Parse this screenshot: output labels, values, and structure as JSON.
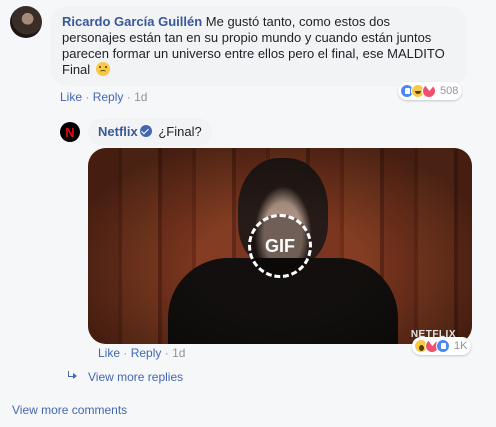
{
  "comment": {
    "author": "Ricardo García Guillén",
    "text": "Me gustó tanto, como estos dos personajes están tan en su propio mundo y cuando están juntos parecen formar un universo entre ellos pero el final, ese MALDITO Final",
    "emoji": "sad-face-emoji",
    "like_label": "Like",
    "reply_label": "Reply",
    "time": "1d",
    "reactions": [
      "like",
      "haha",
      "love"
    ],
    "reaction_count": "508"
  },
  "reply": {
    "author": "Netflix",
    "avatar_letter": "N",
    "verified": true,
    "text": "¿Final?",
    "gif_label": "GIF",
    "gif_watermark": "NETFLIX",
    "like_label": "Like",
    "reply_label": "Reply",
    "time": "1d",
    "reactions": [
      "wow",
      "love",
      "like"
    ],
    "reaction_count": "1K"
  },
  "view_more_replies": "View more replies",
  "view_more_comments": "View more comments",
  "colors": {
    "link": "#385898",
    "action_link": "#4267b2",
    "netflix_red": "#e50914",
    "bubble_bg": "#f2f3f5"
  }
}
